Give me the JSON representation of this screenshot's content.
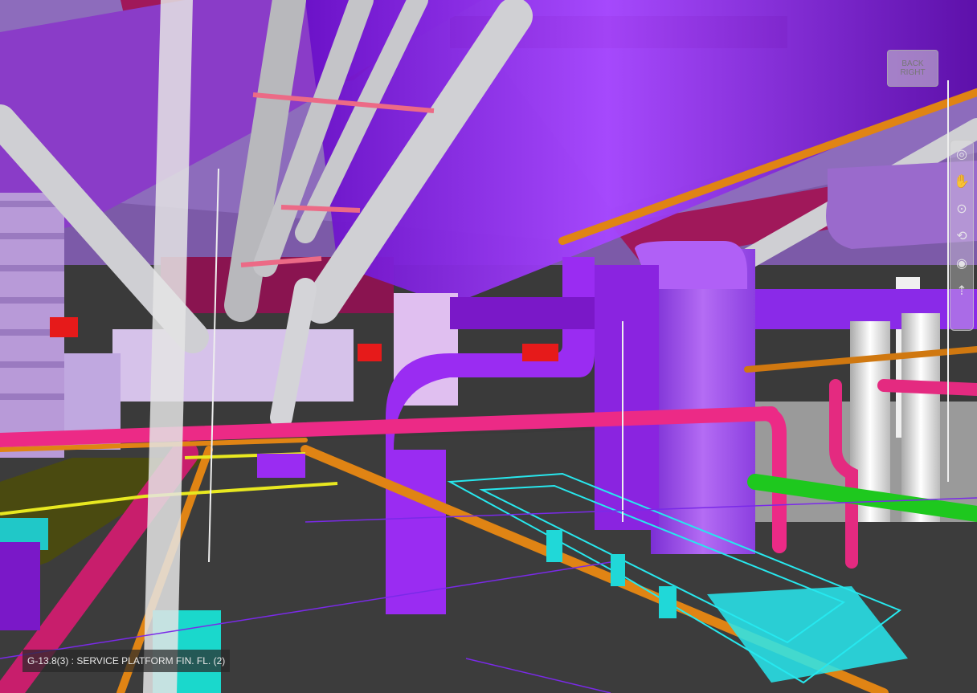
{
  "viewer": {
    "level_label": "G-13.8(3) : SERVICE PLATFORM FIN. FL. (2)",
    "viewcube": {
      "face_top": "BACK",
      "face_right": "RIGHT"
    }
  },
  "navbar": {
    "tools": [
      {
        "name": "steering-wheel-icon",
        "glyph": "◎"
      },
      {
        "name": "pan-hand-icon",
        "glyph": "✋"
      },
      {
        "name": "zoom-icon",
        "glyph": "⊙"
      },
      {
        "name": "orbit-icon",
        "glyph": "⟲"
      },
      {
        "name": "look-icon",
        "glyph": "◉"
      },
      {
        "name": "walk-icon",
        "glyph": "⇡"
      }
    ]
  },
  "colors": {
    "ductwork": "#9a2cf2",
    "ductwork_light": "#c79df2",
    "pipe_grey": "#c8c8cc",
    "pipe_pink": "#ec2a86",
    "pipe_orange": "#e08414",
    "pipe_green": "#1ec81e",
    "cable_tray": "#27e8ee",
    "floor": "#3c3c3c",
    "beam_magenta": "#a0185a",
    "slab_purple": "#8a3cc8"
  }
}
